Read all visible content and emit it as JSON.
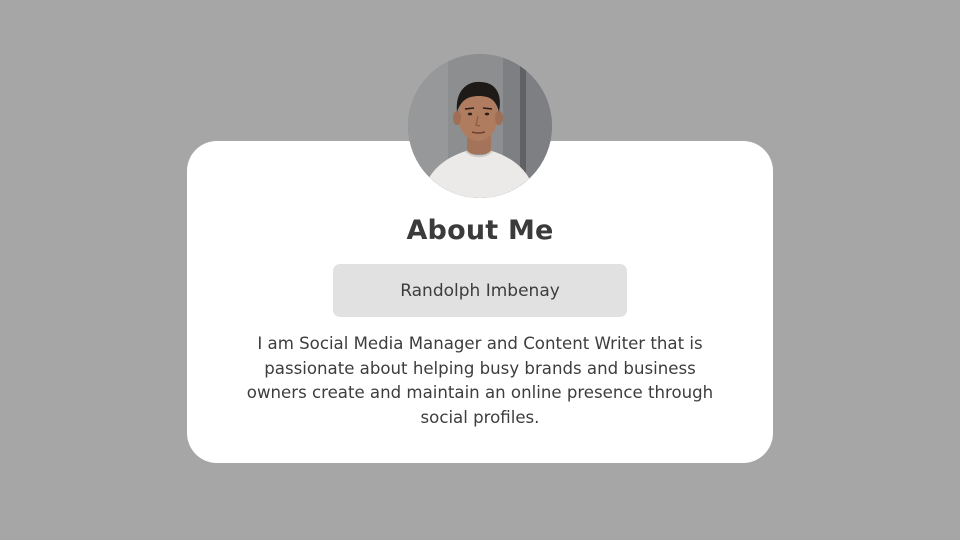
{
  "profile": {
    "heading": "About Me",
    "name": "Randolph Imbenay",
    "bio": "I am Social Media Manager and Content Writer that is passionate about helping busy brands and business owners create and maintain an online presence through social profiles."
  },
  "colors": {
    "background": "#a6a6a6",
    "card": "#ffffff",
    "name_box": "#e2e1e2",
    "text": "#3d3d3d"
  }
}
